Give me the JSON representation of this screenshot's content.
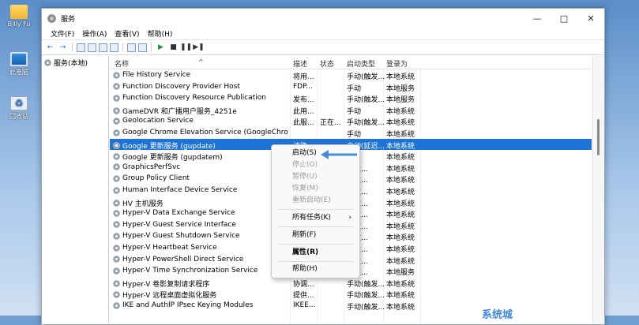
{
  "desktop": {
    "icons": [
      {
        "label": "Billy Fu",
        "icon": "folder-icon"
      },
      {
        "label": "此电脑",
        "icon": "computer-icon"
      },
      {
        "label": "回收站",
        "icon": "recycle-bin-icon"
      }
    ]
  },
  "window": {
    "title": "服务",
    "controls": {
      "minimize": "—",
      "maximize": "□",
      "close": "✕"
    }
  },
  "menubar": [
    {
      "label": "文件(F)"
    },
    {
      "label": "操作(A)"
    },
    {
      "label": "查看(V)"
    },
    {
      "label": "帮助(H)"
    }
  ],
  "toolbar": {
    "back": "←",
    "forward": "→",
    "play": "▶",
    "stop": "■",
    "pause": "❚❚",
    "restart": "▶❚"
  },
  "tree": {
    "root": "服务(本地)"
  },
  "list": {
    "columns": [
      "名称",
      "描述",
      "状态",
      "启动类型",
      "登录为"
    ],
    "rows": [
      {
        "name": "File History Service",
        "desc": "将用...",
        "status": "",
        "startup": "手动(触发...",
        "logon": "本地系统"
      },
      {
        "name": "Function Discovery Provider Host",
        "desc": "FDP...",
        "status": "",
        "startup": "手动",
        "logon": "本地服务"
      },
      {
        "name": "Function Discovery Resource Publication",
        "desc": "发布...",
        "status": "",
        "startup": "手动(触发...",
        "logon": "本地服务"
      },
      {
        "name": "GameDVR 和广播用户服务_4251e",
        "desc": "此用...",
        "status": "",
        "startup": "手动",
        "logon": "本地系统"
      },
      {
        "name": "Geolocation Service",
        "desc": "此服...",
        "status": "正在...",
        "startup": "手动(触发...",
        "logon": "本地系统"
      },
      {
        "name": "Google Chrome Elevation Service (GoogleChrome...",
        "desc": "",
        "status": "",
        "startup": "手动",
        "logon": "本地系统"
      },
      {
        "name": "Google 更新服务 (gupdate)",
        "desc": "请确...",
        "status": "",
        "startup": "自动(延迟...",
        "logon": "本地系统"
      },
      {
        "name": "Google 更新服务 (gupdatem)",
        "desc": "",
        "status": "",
        "startup": "",
        "logon": "本地系统"
      },
      {
        "name": "GraphicsPerfSvc",
        "desc": "",
        "status": "",
        "startup": "触发...",
        "logon": "本地系统"
      },
      {
        "name": "Group Policy Client",
        "desc": "",
        "status": "",
        "startup": "触发...",
        "logon": "本地系统"
      },
      {
        "name": "Human Interface Device Service",
        "desc": "",
        "status": "",
        "startup": "触发...",
        "logon": "本地系统"
      },
      {
        "name": "HV 主机服务",
        "desc": "",
        "status": "",
        "startup": "触发...",
        "logon": "本地系统"
      },
      {
        "name": "Hyper-V Data Exchange Service",
        "desc": "",
        "status": "",
        "startup": "触发...",
        "logon": "本地系统"
      },
      {
        "name": "Hyper-V Guest Service Interface",
        "desc": "",
        "status": "",
        "startup": "触发...",
        "logon": "本地系统"
      },
      {
        "name": "Hyper-V Guest Shutdown Service",
        "desc": "",
        "status": "",
        "startup": "触发...",
        "logon": "本地系统"
      },
      {
        "name": "Hyper-V Heartbeat Service",
        "desc": "",
        "status": "",
        "startup": "触发...",
        "logon": "本地系统"
      },
      {
        "name": "Hyper-V PowerShell Direct Service",
        "desc": "",
        "status": "",
        "startup": "触发...",
        "logon": "本地系统"
      },
      {
        "name": "Hyper-V Time Synchronization Service",
        "desc": "",
        "status": "",
        "startup": "触发...",
        "logon": "本地服务"
      },
      {
        "name": "Hyper-V 卷影复制请求程序",
        "desc": "协调...",
        "status": "",
        "startup": "手动(触发...",
        "logon": "本地系统"
      },
      {
        "name": "Hyper-V 远程桌面虚拟化服务",
        "desc": "提供...",
        "status": "",
        "startup": "手动(触发...",
        "logon": "本地系统"
      },
      {
        "name": "IKE and AuthIP IPsec Keying Modules",
        "desc": "IKEE...",
        "status": "",
        "startup": "手动(触发...",
        "logon": "本地系统"
      }
    ]
  },
  "context_menu": {
    "items": [
      {
        "label": "启动(S)",
        "enabled": true
      },
      {
        "label": "停止(O)",
        "enabled": false
      },
      {
        "label": "暂停(U)",
        "enabled": false
      },
      {
        "label": "恢复(M)",
        "enabled": false
      },
      {
        "label": "重新启动(E)",
        "enabled": false
      },
      {
        "label": "所有任务(K)",
        "enabled": true,
        "submenu": "›"
      },
      {
        "label": "刷新(F)",
        "enabled": true
      },
      {
        "label": "属性(R)",
        "enabled": true,
        "bold": true
      },
      {
        "label": "帮助(H)",
        "enabled": true
      }
    ]
  },
  "watermark": "系统城"
}
